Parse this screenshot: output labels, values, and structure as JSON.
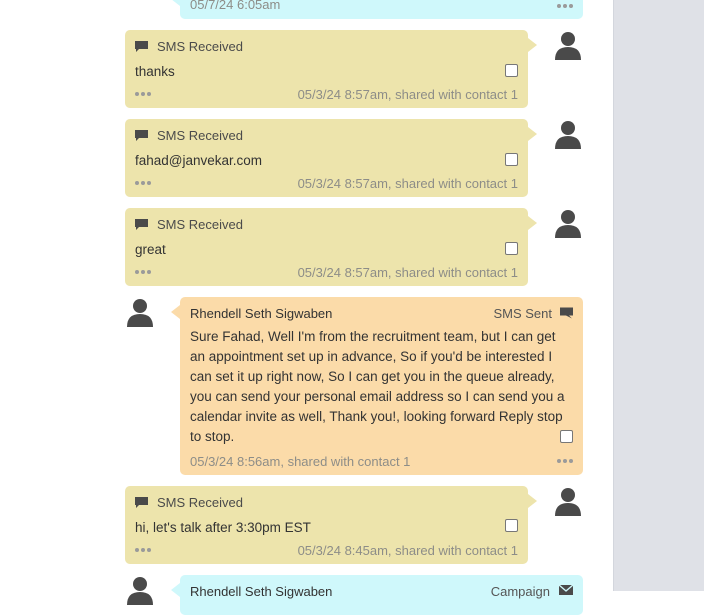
{
  "top_message": {
    "timestamp": "05/7/24 6:05am"
  },
  "messages": [
    {
      "type": "SMS Received",
      "text": "thanks",
      "footer": "05/3/24 8:57am, shared with contact 1"
    },
    {
      "type": "SMS Received",
      "text": "fahad@janvekar.com",
      "footer": "05/3/24 8:57am, shared with contact 1"
    },
    {
      "type": "SMS Received",
      "text": "great",
      "footer": "05/3/24 8:57am, shared with contact 1"
    },
    {
      "sender": "Rhendell Seth Sigwaben",
      "type": "SMS Sent",
      "text": "Sure Fahad, Well I'm from the recruitment team, but I can get an appointment set up in advance, So if you'd be interested I can set it up right now, So I can get you in the queue already, you can send your personal email address so I can send you a calendar invite as well, Thank you!, looking forward Reply stop to stop.",
      "footer": "05/3/24 8:56am, shared with contact 1"
    },
    {
      "type": "SMS Received",
      "text": "hi, let's talk after 3:30pm EST",
      "footer": "05/3/24 8:45am, shared with contact 1"
    }
  ],
  "bottom_message": {
    "sender": "Rhendell Seth Sigwaben",
    "type": "Campaign"
  },
  "colors": {
    "received_bg": "#ede4ac",
    "sent_bg": "#fbdba9",
    "campaign_bg": "#cff8fb",
    "gutter": "#dfe1e7"
  },
  "icons": [
    "chat-bubble-icon",
    "user-avatar-icon",
    "more-dots-icon",
    "envelope-icon"
  ]
}
